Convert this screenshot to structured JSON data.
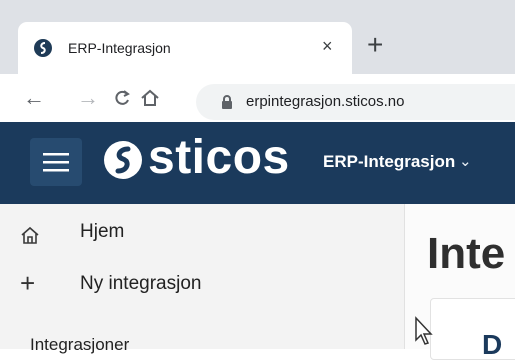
{
  "browser": {
    "tab_title": "ERP-Integrasjon",
    "tab_close": "×",
    "new_tab": "+",
    "nav": {
      "back": "←",
      "forward": "→"
    },
    "url": "erpintegrasjon.sticos.no"
  },
  "header": {
    "brand": "sticos",
    "product_switcher": {
      "label": "ERP-Integrasjon",
      "chevron": "⌄"
    },
    "colors": {
      "background": "#1b3a5c",
      "menu_button": "#274b70"
    }
  },
  "sidebar": {
    "items": [
      {
        "label": "Hjem",
        "icon": "home-icon"
      },
      {
        "label": "Ny integrasjon",
        "icon": "plus-icon",
        "glyph": "+"
      }
    ],
    "section_heading": "Integrasjoner"
  },
  "main": {
    "title": "Inte",
    "card_text": "D"
  }
}
